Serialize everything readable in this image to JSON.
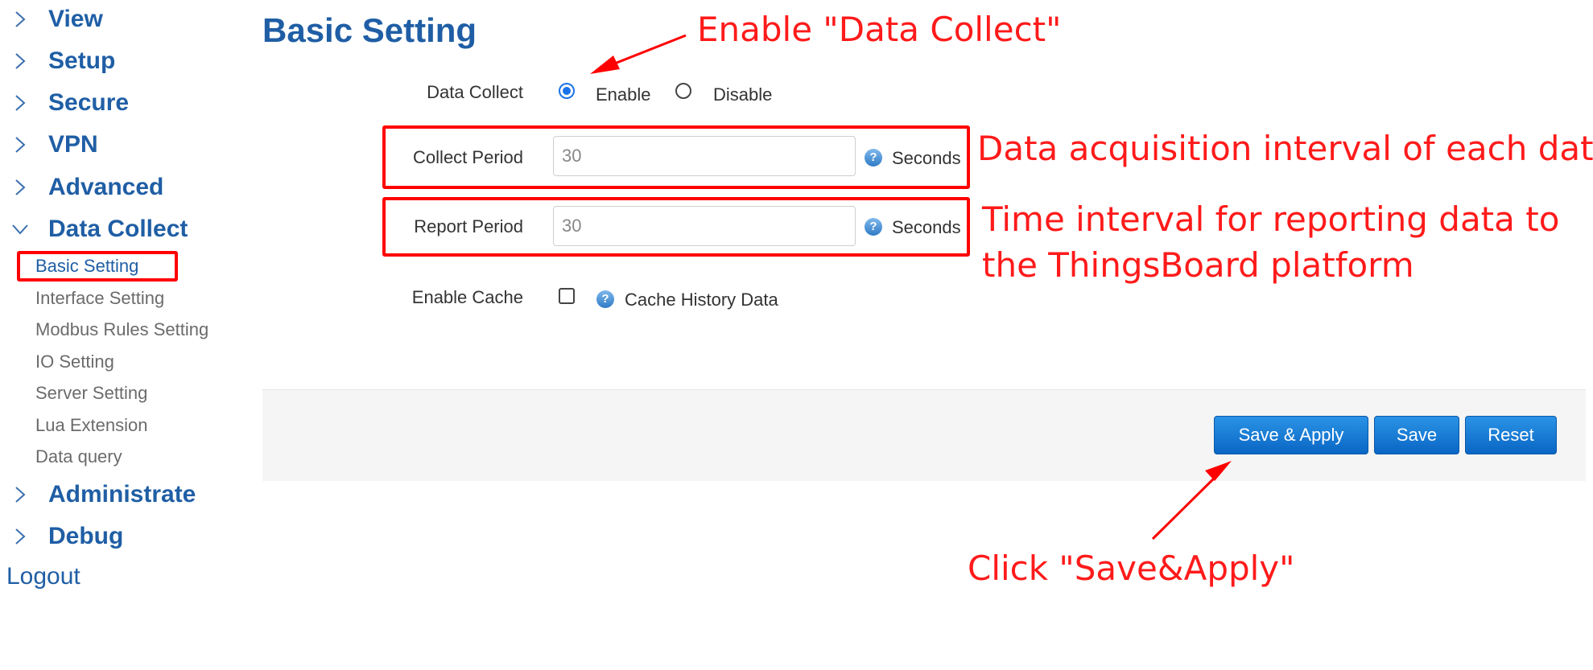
{
  "sidebar": {
    "menu": [
      {
        "label": "View",
        "expanded": false
      },
      {
        "label": "Setup",
        "expanded": false
      },
      {
        "label": "Secure",
        "expanded": false
      },
      {
        "label": "VPN",
        "expanded": false
      },
      {
        "label": "Advanced",
        "expanded": false
      },
      {
        "label": "Data Collect",
        "expanded": true
      },
      {
        "label": "Administrate",
        "expanded": false
      },
      {
        "label": "Debug",
        "expanded": false
      }
    ],
    "data_collect_items": [
      "Basic Setting",
      "Interface Setting",
      "Modbus Rules Setting",
      "IO Setting",
      "Server Setting",
      "Lua Extension",
      "Data query"
    ],
    "active_item": "Basic Setting",
    "logout": "Logout"
  },
  "main": {
    "title": "Basic Setting",
    "data_collect": {
      "label": "Data Collect",
      "enable_label": "Enable",
      "disable_label": "Disable",
      "selected": "Enable"
    },
    "collect_period": {
      "label": "Collect Period",
      "value": "30",
      "unit": "Seconds"
    },
    "report_period": {
      "label": "Report Period",
      "value": "30",
      "unit": "Seconds"
    },
    "enable_cache": {
      "label": "Enable Cache",
      "checked": false,
      "hint": "Cache History Data"
    },
    "help_glyph": "?",
    "buttons": {
      "save_apply": "Save & Apply",
      "save": "Save",
      "reset": "Reset"
    }
  },
  "annotations": {
    "enable_data_collect": "Enable \"Data Collect\"",
    "collect_interval": "Data acquisition interval of each data",
    "report_interval_line1": "Time interval for reporting data to",
    "report_interval_line2": "the ThingsBoard platform",
    "click_save_apply": "Click \"Save&Apply\""
  },
  "colors": {
    "brand_blue": "#1f5ea5",
    "annotation_red": "#ff1a1a",
    "button_blue": "#0a66c4",
    "radio_blue": "#1a73e8"
  }
}
